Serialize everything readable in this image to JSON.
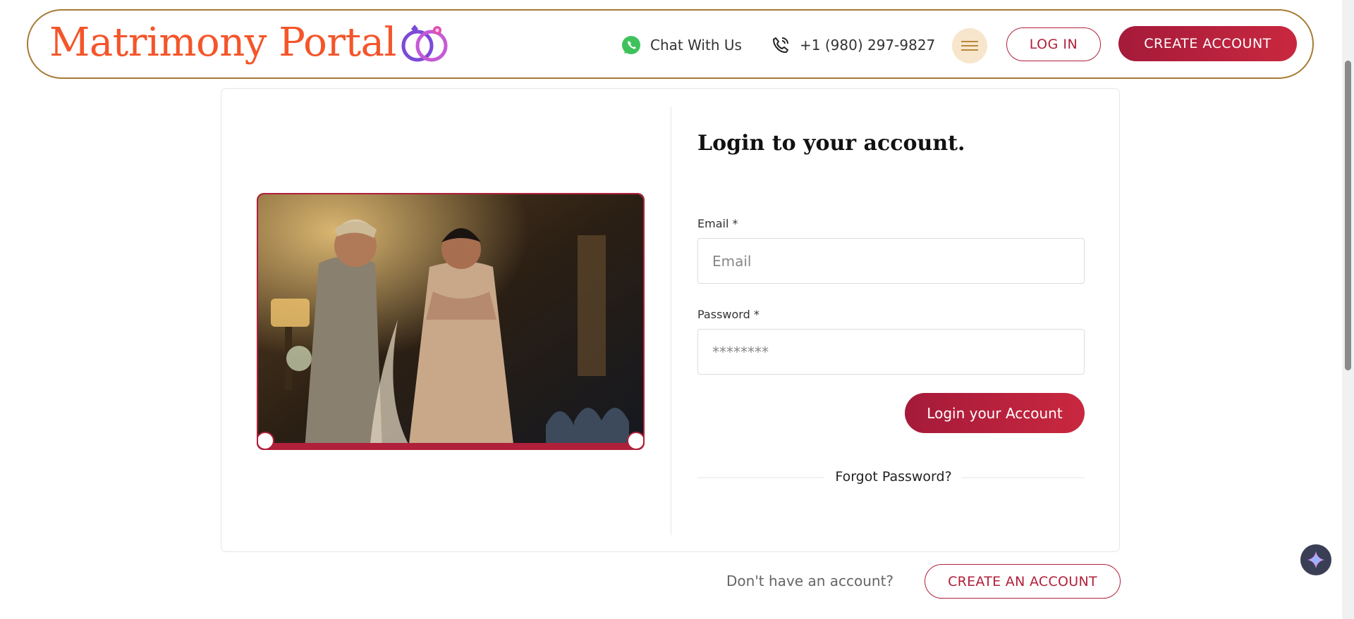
{
  "header": {
    "logo_text": "Matrimony Portal",
    "chat_label": "Chat With Us",
    "phone_label": "+1 (980) 297-9827",
    "login_label": "LOG IN",
    "create_label": "CREATE ACCOUNT"
  },
  "login": {
    "title": "Login to your account.",
    "email_label": "Email *",
    "email_placeholder": "Email",
    "password_label": "Password *",
    "password_placeholder": "********",
    "submit_label": "Login your Account",
    "forgot_label": "Forgot Password?"
  },
  "footer": {
    "no_account_text": "Don't have an account?",
    "create_account_label": "CREATE AN ACCOUNT"
  },
  "colors": {
    "brand_orange": "#f4552a",
    "accent_crimson": "#b0203a",
    "header_border": "#a87a35"
  },
  "icons": [
    "whatsapp-icon",
    "phone-icon",
    "hamburger-icon",
    "sparkle-icon"
  ]
}
